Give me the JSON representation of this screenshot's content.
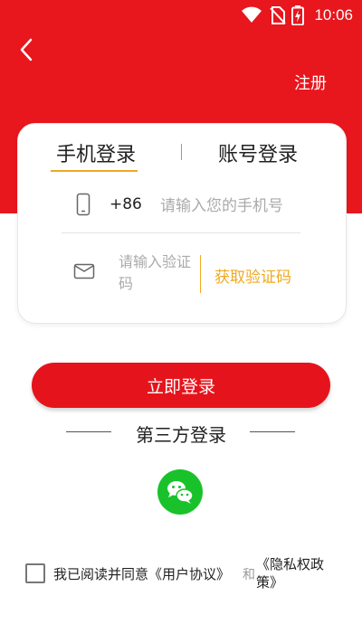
{
  "status_bar": {
    "time": "10:06"
  },
  "header": {
    "register_label": "注册"
  },
  "login_card": {
    "tabs": [
      {
        "label": "手机登录",
        "active": true
      },
      {
        "label": "账号登录",
        "active": false
      }
    ],
    "phone": {
      "country_code": "+86",
      "placeholder": "请输入您的手机号",
      "value": ""
    },
    "code": {
      "placeholder": "请输入验证码",
      "value": "",
      "get_code_label": "获取验证码"
    }
  },
  "login_button_label": "立即登录",
  "third_party": {
    "title": "第三方登录"
  },
  "agreement": {
    "checked": false,
    "prefix": "我已阅读并同意",
    "user_agreement": "《用户协议》",
    "and": "和",
    "privacy_policy": "《隐私权政策》"
  },
  "colors": {
    "primary_red": "#e8161d",
    "accent_orange": "#f0a91e",
    "wechat_green": "#19c22a"
  },
  "icons": [
    "back-arrow-icon",
    "wifi-icon",
    "no-sim-icon",
    "battery-charging-icon",
    "phone-icon",
    "mail-icon",
    "wechat-icon"
  ]
}
